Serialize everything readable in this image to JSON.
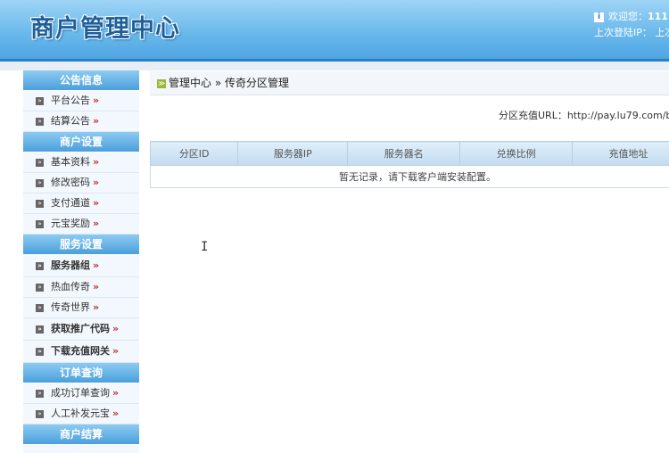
{
  "header": {
    "logo": "商户管理中心",
    "welcome": "欢迎您：",
    "username": "111",
    "last_login": "上次登陆IP：",
    "last_login_tail": "上次"
  },
  "sidebar": {
    "sections": [
      {
        "title": "公告信息",
        "items": [
          {
            "label": "平台公告",
            "bold": false
          },
          {
            "label": "结算公告",
            "bold": false
          }
        ]
      },
      {
        "title": "商户设置",
        "items": [
          {
            "label": "基本资料",
            "bold": false
          },
          {
            "label": "修改密码",
            "bold": false
          },
          {
            "label": "支付通道",
            "bold": false
          },
          {
            "label": "元宝奖励",
            "bold": false
          }
        ]
      },
      {
        "title": "服务设置",
        "items": [
          {
            "label": "服务器组",
            "bold": true
          },
          {
            "label": "热血传奇",
            "bold": false
          },
          {
            "label": "传奇世界",
            "bold": false
          },
          {
            "label": "获取推广代码",
            "bold": true
          },
          {
            "label": "下载充值网关",
            "bold": true
          }
        ]
      },
      {
        "title": "订单查询",
        "items": [
          {
            "label": "成功订单查询",
            "bold": false
          },
          {
            "label": "人工补发元宝",
            "bold": false
          }
        ]
      },
      {
        "title": "商户结算",
        "items": []
      }
    ],
    "arrow": "»"
  },
  "breadcrumb": {
    "home": "管理中心",
    "sep": "»",
    "current": "传奇分区管理"
  },
  "recharge_url": "分区充值URL：http://pay.lu79.com/b",
  "table": {
    "columns": [
      "分区ID",
      "服务器IP",
      "服务器名",
      "兑换比例",
      "充值地址"
    ],
    "empty_message": "暂无记录，请下载客户端安装配置。"
  }
}
